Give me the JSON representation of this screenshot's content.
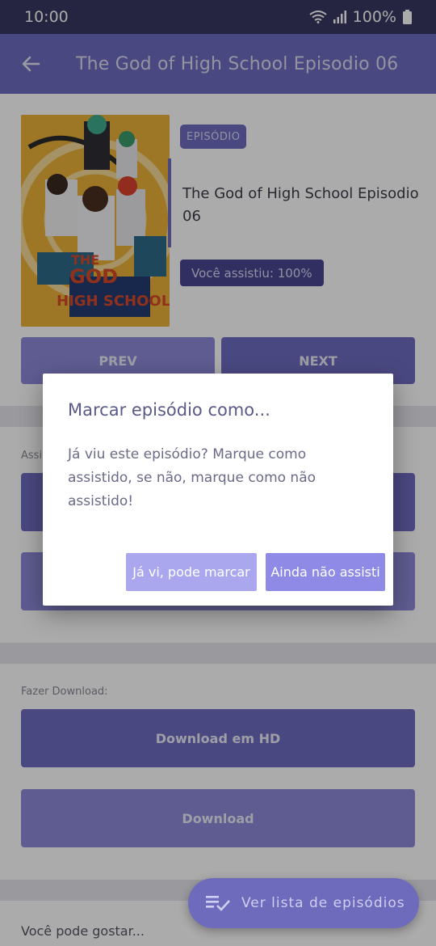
{
  "status_bar": {
    "time": "10:00",
    "battery": "100%"
  },
  "app_bar": {
    "title": "The God of High School Episodio 06"
  },
  "episode": {
    "type_badge": "EPISÓDIO",
    "title": "The God of High School Episodio 06",
    "watched_badge": "Você assistiu: 100%",
    "poster_text_line1": "THE",
    "poster_text_line2": "GOD",
    "poster_text_line3": "HIGH SCHOOL",
    "watched_progress_percent": 100
  },
  "nav": {
    "prev_label": "PREV",
    "next_label": "NEXT"
  },
  "download": {
    "section_label": "Fazer Download:",
    "hd_label": "Download em HD",
    "sd_label": "Download"
  },
  "watch_section": {
    "label_partial": "Assi"
  },
  "dialog": {
    "title": "Marcar episódio como...",
    "body": "Já viu este episódio? Marque como assistido, se não, marque como não assistido!",
    "confirm_label": "Já vi, pode marcar",
    "deny_label": "Ainda não assisti"
  },
  "footer": {
    "suggestions_label": "Você pode gostar..."
  },
  "fab": {
    "label": "Ver lista de episódios",
    "icon": "playlist-check-icon"
  },
  "colors": {
    "primary": "#6f6cc0",
    "primary_dark": "#383862",
    "dialog_confirm": "#aaa7ee",
    "dialog_deny": "#8e8ae6"
  }
}
